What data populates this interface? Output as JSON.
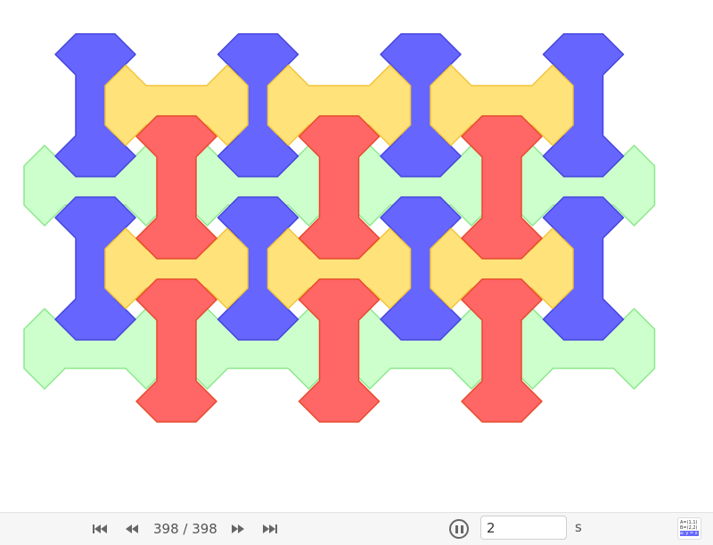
{
  "app": {
    "type": "geogebra-applet"
  },
  "tiling": {
    "colors": {
      "blue": {
        "fill": "#6666ff",
        "stroke": "#4444dd"
      },
      "yellow": {
        "fill": "#ffe27a",
        "stroke": "#f2c43a"
      },
      "red": {
        "fill": "#ff6666",
        "stroke": "#e64a2a"
      },
      "green": {
        "fill": "#ccffcc",
        "stroke": "#8ce88c"
      }
    },
    "columns": 4,
    "rows": 2
  },
  "animation": {
    "step_text": "398 / 398",
    "speed_value": "2",
    "speed_unit": "s"
  },
  "icons": {
    "first": "skip-to-start-icon",
    "prev": "step-back-icon",
    "next": "step-forward-icon",
    "last": "skip-to-end-icon",
    "pause": "pause-icon",
    "algebra": "algebra-view-icon"
  },
  "algebra_icon": {
    "line1": "A=(1,1)",
    "line2": "B=(2,2)",
    "line3": "a: y = x"
  }
}
